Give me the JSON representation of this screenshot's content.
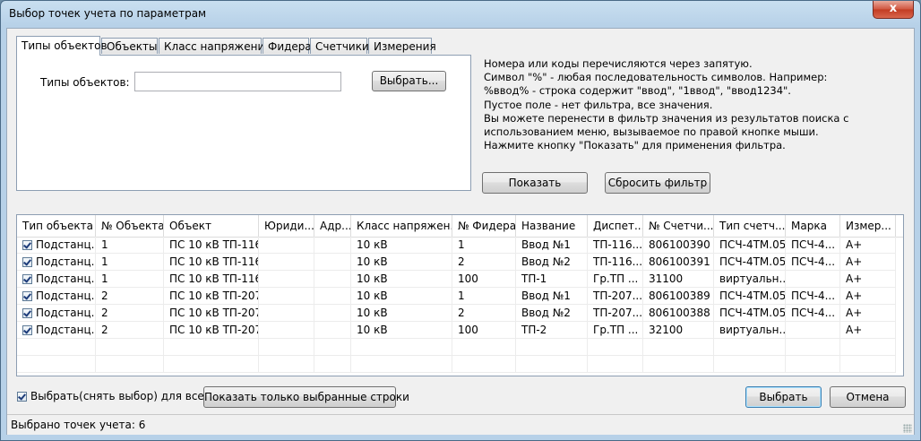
{
  "window": {
    "title": "Выбор точек учета по параметрам",
    "close_glyph": "x"
  },
  "tabs": [
    {
      "label": "Типы объектов",
      "active": true
    },
    {
      "label": "Объекты"
    },
    {
      "label": "Класс напряжения"
    },
    {
      "label": "Фидера"
    },
    {
      "label": "Счетчики"
    },
    {
      "label": "Измерения"
    }
  ],
  "panel": {
    "field_label": "Типы объектов:",
    "field_value": "",
    "choose_button": "Выбрать..."
  },
  "help": [
    "Номера или коды перечисляются через запятую.",
    "Символ \"%\" - любая последовательность символов. Например:",
    "%ввод% - строка содержит \"ввод\", \"1ввод\", \"ввод1234\".",
    "Пустое поле - нет фильтра, все значения.",
    "Вы можете перенести в фильтр значения  из результатов поиска с",
    "использованием меню, вызываемое по правой кнопке мыши.",
    "Нажмите кнопку \"Показать\" для применения фильтра."
  ],
  "buttons": {
    "show": "Показать",
    "reset_filter": "Сбросить фильтр",
    "show_selected": "Показать только выбранные строки",
    "select": "Выбрать",
    "cancel": "Отмена"
  },
  "table": {
    "columns": [
      "Тип объекта",
      "№ Объекта",
      "Объект",
      "Юриди...",
      "Адр...",
      "Класс напряжен...",
      "№ Фидера",
      "Название",
      "Диспет...",
      "№ Счетчи...",
      "Тип счетч...",
      "Марка",
      "Измер..."
    ],
    "rows": [
      {
        "checked": true,
        "cells": [
          "Подстанц...",
          "1",
          "ПС 10 кВ ТП-116",
          "",
          "",
          "10 кВ",
          "1",
          "Ввод №1",
          "ТП-116...",
          "806100390",
          "ПСЧ-4ТМ.05",
          "ПСЧ-4...",
          "A+"
        ]
      },
      {
        "checked": true,
        "cells": [
          "Подстанц...",
          "1",
          "ПС 10 кВ ТП-116",
          "",
          "",
          "10 кВ",
          "2",
          "Ввод №2",
          "ТП-116...",
          "806100391",
          "ПСЧ-4ТМ.05",
          "ПСЧ-4...",
          "A+"
        ]
      },
      {
        "checked": true,
        "cells": [
          "Подстанц...",
          "1",
          "ПС 10 кВ ТП-116",
          "",
          "",
          "10 кВ",
          "100",
          "ТП-1",
          "Гр.ТП ...",
          "31100",
          "виртуальн...",
          "",
          "A+"
        ]
      },
      {
        "checked": true,
        "cells": [
          "Подстанц...",
          "2",
          "ПС 10 кВ ТП-207",
          "",
          "",
          "10 кВ",
          "1",
          "Ввод №1",
          "ТП-207...",
          "806100389",
          "ПСЧ-4ТМ.05",
          "ПСЧ-4...",
          "A+"
        ]
      },
      {
        "checked": true,
        "cells": [
          "Подстанц...",
          "2",
          "ПС 10 кВ ТП-207",
          "",
          "",
          "10 кВ",
          "2",
          "Ввод №2",
          "ТП-207...",
          "806100388",
          "ПСЧ-4ТМ.05",
          "ПСЧ-4...",
          "A+"
        ]
      },
      {
        "checked": true,
        "cells": [
          "Подстанц...",
          "2",
          "ПС 10 кВ ТП-207",
          "",
          "",
          "10 кВ",
          "100",
          "ТП-2",
          "Гр.ТП ...",
          "32100",
          "виртуальн...",
          "",
          "A+"
        ]
      }
    ]
  },
  "select_all": {
    "label": "Выбрать(снять выбор) для всех",
    "checked": true
  },
  "status": {
    "text": "Выбрано точек учета: 6"
  }
}
